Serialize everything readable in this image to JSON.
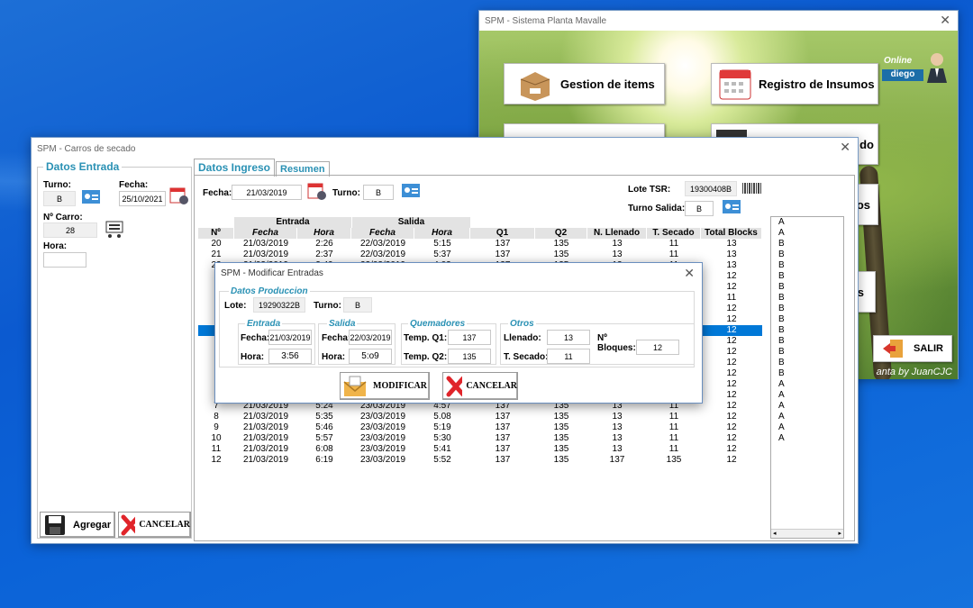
{
  "main_window": {
    "title": "SPM - Sistema Planta Mavalle",
    "online_label": "Online",
    "user": "diego",
    "buttons": {
      "gestion": "Gestion de items",
      "registro": "Registro de Insumos",
      "partial3": "do",
      "partial4": "os",
      "partial5": "s",
      "salir": "SALIR"
    },
    "credit": "anta by JuanCJC"
  },
  "carros_window": {
    "title": "SPM - Carros de secado",
    "left_frame": {
      "title": "Datos Entrada",
      "turno_label": "Turno:",
      "turno_value": "B",
      "fecha_label": "Fecha:",
      "fecha_value": "25/10/2021",
      "carro_label": "Nº Carro:",
      "carro_value": "28",
      "hora_label": "Hora:",
      "hora_value": ""
    },
    "tabs": [
      "Datos Ingreso",
      "Resumen"
    ],
    "filters": {
      "fecha_label": "Fecha:",
      "fecha_value": "21/03/2019",
      "turno_label": "Turno:",
      "turno_value": "B",
      "lote_label": "Lote TSR:",
      "lote_value": "19300408B",
      "turno_salida_label": "Turno Salida:",
      "turno_salida_value": "B"
    },
    "table": {
      "group_headers": [
        "Entrada",
        "Salida"
      ],
      "columns": [
        "Nº",
        "Fecha",
        "Hora",
        "Fecha",
        "Hora",
        "Q1",
        "Q2",
        "N. Llenado",
        "T. Secado",
        "Total Blocks"
      ],
      "rows_top": [
        [
          "20",
          "21/03/2019",
          "2:26",
          "22/03/2019",
          "5:15",
          "137",
          "135",
          "13",
          "11",
          "13"
        ],
        [
          "21",
          "21/03/2019",
          "2:37",
          "22/03/2019",
          "5:37",
          "137",
          "135",
          "13",
          "11",
          "13"
        ],
        [
          "22",
          "21/03/2019",
          "2:49",
          "22/03/2019",
          "4:03",
          "137",
          "135",
          "13",
          "11",
          "13"
        ]
      ],
      "hidden_totals": [
        "12",
        "12",
        "11",
        "12",
        "12",
        "12",
        "12",
        "12",
        "12",
        "12",
        "12",
        "12"
      ],
      "rows_bottom": [
        [
          "7",
          "21/03/2019",
          "5:24",
          "23/03/2019",
          "4:57",
          "137",
          "135",
          "13",
          "11",
          "12"
        ],
        [
          "8",
          "21/03/2019",
          "5:35",
          "23/03/2019",
          "5.08",
          "137",
          "135",
          "13",
          "11",
          "12"
        ],
        [
          "9",
          "21/03/2019",
          "5:46",
          "23/03/2019",
          "5:19",
          "137",
          "135",
          "13",
          "11",
          "12"
        ],
        [
          "10",
          "21/03/2019",
          "5:57",
          "23/03/2019",
          "5:30",
          "137",
          "135",
          "13",
          "11",
          "12"
        ],
        [
          "11",
          "21/03/2019",
          "6:08",
          "23/03/2019",
          "5:41",
          "137",
          "135",
          "13",
          "11",
          "12"
        ],
        [
          "12",
          "21/03/2019",
          "6:19",
          "23/03/2019",
          "5:52",
          "137",
          "135",
          "137",
          "135",
          "12"
        ]
      ]
    },
    "list_items": [
      "A",
      "A",
      "B",
      "B",
      "B",
      "B",
      "B",
      "B",
      "B",
      "B",
      "B",
      "B",
      "B",
      "B",
      "B",
      "A",
      "A",
      "A",
      "A",
      "A",
      "A"
    ],
    "buttons": {
      "agregar": "Agregar",
      "cancelar": "CANCELAR"
    }
  },
  "modal": {
    "title": "SPM - Modificar Entradas",
    "datos_produccion": "Datos Produccion",
    "lote_label": "Lote:",
    "lote_value": "19290322B",
    "turno_label": "Turno:",
    "turno_value": "B",
    "entrada": {
      "title": "Entrada",
      "fecha_label": "Fecha:",
      "fecha_value": "21/03/2019",
      "hora_label": "Hora:",
      "hora_value": "3:56"
    },
    "salida": {
      "title": "Salida",
      "fecha_label": "Fecha:",
      "fecha_value": "22/03/2019",
      "hora_label": "Hora:",
      "hora_value": "5:o9"
    },
    "quemadores": {
      "title": "Quemadores",
      "q1_label": "Temp. Q1:",
      "q1_value": "137",
      "q2_label": "Temp. Q2:",
      "q2_value": "135"
    },
    "otros": {
      "title": "Otros",
      "llenado_label": "Llenado:",
      "llenado_value": "13",
      "secado_label": "T. Secado:",
      "secado_value": "11",
      "bloques_label_1": "Nº",
      "bloques_label_2": "Bloques:",
      "bloques_value": "12"
    },
    "buttons": {
      "modificar": "MODIFICAR",
      "cancelar": "CANCELAR"
    }
  },
  "colors": {
    "accent": "#2a91b4",
    "selection": "#0078d7",
    "desktop": "#0b5ad0"
  }
}
